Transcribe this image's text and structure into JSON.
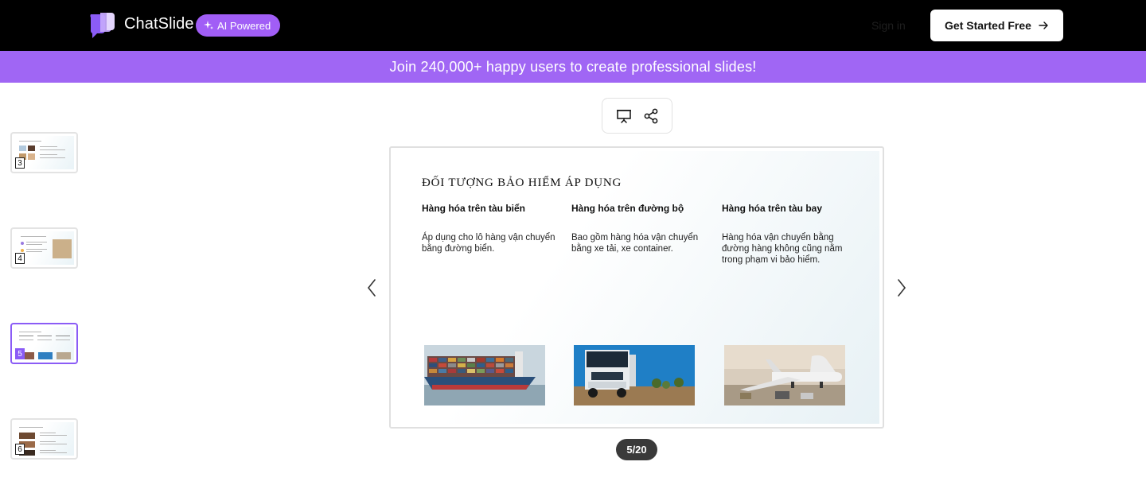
{
  "header": {
    "brand": "ChatSlide",
    "badge": "AI Powered",
    "sign_in": "Sign in",
    "cta": "Get Started Free"
  },
  "banner": {
    "text": "Join 240,000+ happy users to create professional slides!"
  },
  "thumbnails": [
    {
      "number": "3",
      "active": false
    },
    {
      "number": "4",
      "active": false
    },
    {
      "number": "5",
      "active": true
    },
    {
      "number": "6",
      "active": false
    }
  ],
  "toolbar": {
    "present_icon": "presentation-icon",
    "share_icon": "share-icon"
  },
  "slide": {
    "title": "ĐỐI TƯỢNG BẢO HIỂM ÁP DỤNG",
    "columns": [
      {
        "heading": "Hàng hóa trên tàu biển",
        "body": "Áp dụng cho lô hàng vận chuyển bằng đường biển.",
        "image": "container-ship-image"
      },
      {
        "heading": "Hàng hóa trên đường bộ",
        "body": "Bao gồm hàng hóa vận chuyển bằng xe tải, xe container.",
        "image": "truck-image"
      },
      {
        "heading": "Hàng hóa trên tàu bay",
        "body": "Hàng hóa vận chuyển bằng đường hàng không cũng nằm trong phạm vi bảo hiểm.",
        "image": "cargo-plane-image"
      }
    ]
  },
  "pagination": {
    "counter": "5/20"
  },
  "colors": {
    "accent": "#a066f4",
    "badge": "#a15ef6",
    "active_border": "#8b5cf6",
    "counter_bg": "#3a3a3a"
  }
}
